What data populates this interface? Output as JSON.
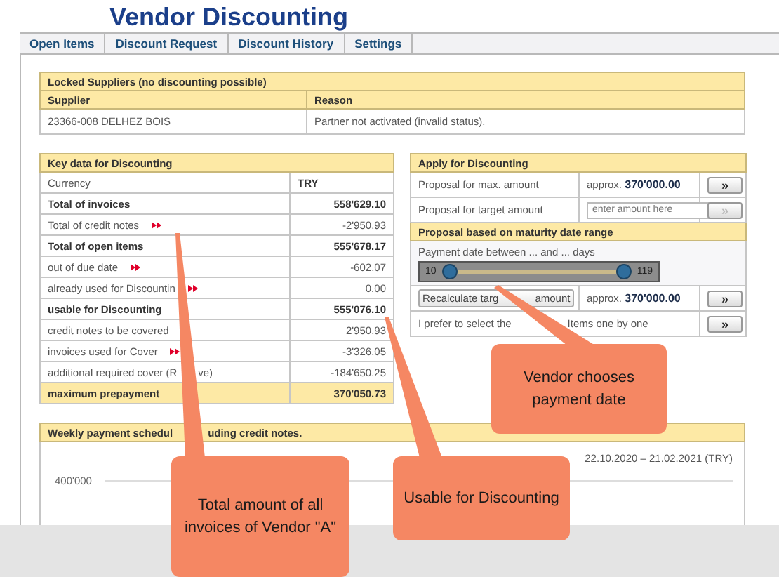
{
  "title": "Vendor Discounting",
  "tabs": [
    {
      "label": "Open Items",
      "selected": false
    },
    {
      "label": "Discount Request",
      "selected": false
    },
    {
      "label": "Discount History",
      "selected": false
    },
    {
      "label": "Settings",
      "selected": false
    }
  ],
  "locked": {
    "title": "Locked Suppliers (no discounting possible)",
    "columns": [
      "Supplier",
      "Reason"
    ],
    "rows": [
      [
        "23366-008 DELHEZ BOIS",
        "Partner not activated (invalid status)."
      ]
    ]
  },
  "key_data": {
    "title": "Key data for Discounting",
    "rows": [
      {
        "label": "Currency",
        "value": "TRY",
        "kind": "head",
        "link": false
      },
      {
        "label": "Total of invoices",
        "value": "558'629.10",
        "kind": "bold",
        "link": false
      },
      {
        "label": "Total of credit notes",
        "value": "-2'950.93",
        "kind": "plain",
        "link": true
      },
      {
        "label": "Total of open items",
        "value": "555'678.17",
        "kind": "bold",
        "link": false
      },
      {
        "label": "out of due date",
        "value": "-602.07",
        "kind": "plain",
        "link": true
      },
      {
        "label": "already used for Discountin",
        "value": "0.00",
        "kind": "plain",
        "link": true
      },
      {
        "label": "usable for Discounting",
        "value": "555'076.10",
        "kind": "bold",
        "link": false
      },
      {
        "label": "credit notes to be covered",
        "value": "2'950.93",
        "kind": "plain",
        "link": false
      },
      {
        "label": "invoices used for Cover",
        "value": "-3'326.05",
        "kind": "plain",
        "link": true
      },
      {
        "label": "additional required cover (R",
        "label_tail": "ve)",
        "value": "-184'650.25",
        "kind": "plain",
        "link": false
      },
      {
        "label": "maximum prepayment",
        "value": "370'050.73",
        "kind": "total",
        "link": false
      }
    ]
  },
  "apply": {
    "title": "Apply for Discounting",
    "max_row": {
      "label": "Proposal for max. amount",
      "prefix": "approx.",
      "amount": "370'000.00",
      "button": "»",
      "disabled": false
    },
    "target_row": {
      "label": "Proposal for target amount",
      "placeholder": "enter amount here",
      "button": "»",
      "disabled": true
    },
    "range_title": "Proposal based on maturity date range",
    "range_label": "Payment date between ... and ... days",
    "range_min": "10",
    "range_max": "119",
    "level": 1,
    "recalc_row": {
      "button_label": "Recalculate targ",
      "button_tail": "amount",
      "prefix": "approx.",
      "amount": "370'000.00",
      "button": "»",
      "disabled": false
    },
    "select_row": {
      "label": "I prefer to select the",
      "label_tail": "Items one by one",
      "button": "»",
      "disabled": false
    }
  },
  "weekly": {
    "title": "Weekly payment schedul",
    "title_tail": "uding credit notes.",
    "period": "22.10.2020 – 21.02.2021 (TRY)",
    "y_tick": "400'000"
  },
  "callouts": [
    "Total amount of all invoices of Vendor \"A\"",
    "Usable for Discounting",
    "Vendor chooses payment date"
  ]
}
